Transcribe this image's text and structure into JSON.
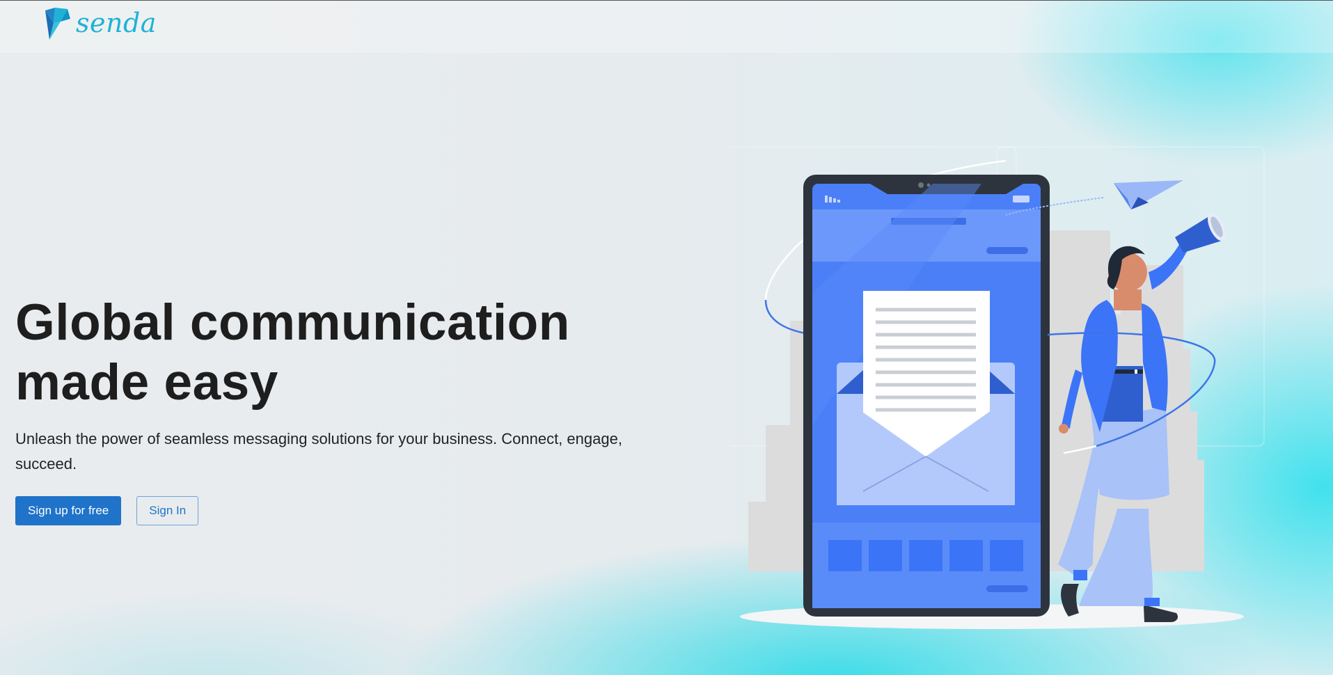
{
  "header": {
    "brand": "senda"
  },
  "hero": {
    "title_line1": "Global communication",
    "title_line2": "made easy",
    "subtitle": "Unleash the power of seamless messaging solutions for your business. Connect, engage, succeed.",
    "primary_button": "Sign up for free",
    "secondary_button": "Sign In"
  },
  "colors": {
    "brand": "#1fb2d6",
    "primary": "#1f73c9",
    "phone_blue": "#4a7ff7"
  },
  "icons": {
    "logo": "senda-logo-icon"
  }
}
